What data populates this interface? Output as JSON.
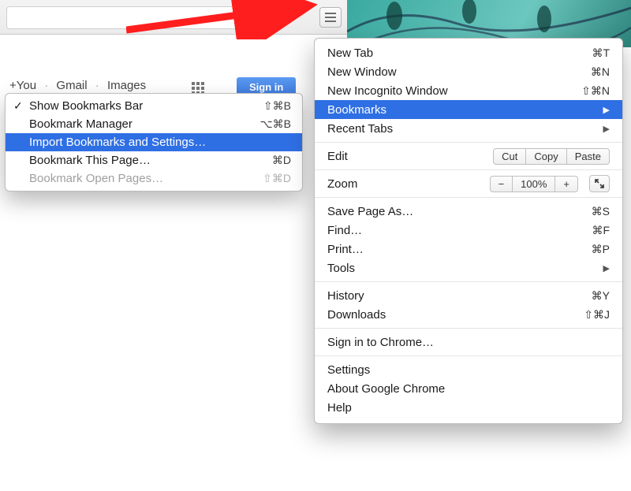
{
  "page_peek": {
    "link_you": "+You",
    "link_gmail": "Gmail",
    "link_images": "Images",
    "sign_in": "Sign in"
  },
  "submenu": {
    "items": [
      {
        "label": "Show Bookmarks Bar",
        "shortcut": "⇧⌘B",
        "checked": true
      },
      {
        "label": "Bookmark Manager",
        "shortcut": "⌥⌘B"
      },
      {
        "label": "Import Bookmarks and Settings…",
        "highlight": true
      },
      {
        "label": "Bookmark This Page…",
        "shortcut": "⌘D"
      },
      {
        "label": "Bookmark Open Pages…",
        "shortcut": "⇧⌘D",
        "disabled": true
      }
    ]
  },
  "mainmenu": {
    "new_tab": {
      "label": "New Tab",
      "shortcut": "⌘T"
    },
    "new_window": {
      "label": "New Window",
      "shortcut": "⌘N"
    },
    "new_incognito": {
      "label": "New Incognito Window",
      "shortcut": "⇧⌘N"
    },
    "bookmarks": {
      "label": "Bookmarks"
    },
    "recent_tabs": {
      "label": "Recent Tabs"
    },
    "edit": {
      "label": "Edit",
      "cut": "Cut",
      "copy": "Copy",
      "paste": "Paste"
    },
    "zoom": {
      "label": "Zoom",
      "value": "100%"
    },
    "save_as": {
      "label": "Save Page As…",
      "shortcut": "⌘S"
    },
    "find": {
      "label": "Find…",
      "shortcut": "⌘F"
    },
    "print": {
      "label": "Print…",
      "shortcut": "⌘P"
    },
    "tools": {
      "label": "Tools"
    },
    "history": {
      "label": "History",
      "shortcut": "⌘Y"
    },
    "downloads": {
      "label": "Downloads",
      "shortcut": "⇧⌘J"
    },
    "sign_in": {
      "label": "Sign in to Chrome…"
    },
    "settings": {
      "label": "Settings"
    },
    "about": {
      "label": "About Google Chrome"
    },
    "help": {
      "label": "Help"
    }
  }
}
